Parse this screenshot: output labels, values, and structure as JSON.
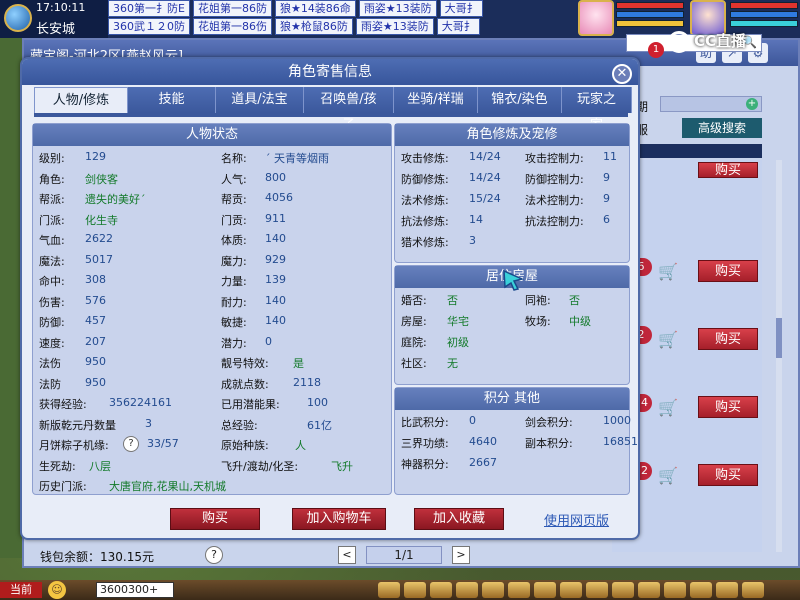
{
  "top": {
    "time": "17:10:11",
    "city": "长安城",
    "stalls_row1": [
      "360第一扌防E",
      "花姐第一86防",
      "狼★14装86命",
      "雨姿★13装防",
      "大哥扌"
    ],
    "stalls_row2": [
      "360武１２0防",
      "花姐第一86伤",
      "狼★枪鼠86防",
      "雨姿★13装防",
      "大哥扌"
    ]
  },
  "bg_window": {
    "title": "藏宝阁-河北2区[燕赵风云]",
    "icons": [
      "助",
      "↗",
      "⚙"
    ],
    "publicity_label": "公示期",
    "cross_server_label": "合跨服",
    "advanced_search": "高级搜索",
    "buy_label": "购买",
    "row_counts": [
      "6",
      "2",
      "54",
      "52"
    ],
    "wallet": "钱包余额：130.15元",
    "page": "1/1",
    "prev": "<",
    "next": ">",
    "help": "?"
  },
  "watermark": {
    "logo": "CC直播",
    "badge": "1"
  },
  "dialog": {
    "title": "角色寄售信息",
    "close": "✕",
    "tabs": [
      "人物/修炼",
      "技能",
      "道具/法宝",
      "召唤兽/孩子",
      "坐骑/祥瑞",
      "锦衣/染色",
      "玩家之家"
    ],
    "status": {
      "header": "人物状态",
      "left_col": [
        {
          "label": "级别:",
          "value": "129"
        },
        {
          "label": "角色:",
          "value": "剑侠客"
        },
        {
          "label": "帮派:",
          "value": "遗失的美好´"
        },
        {
          "label": "门派:",
          "value": "化生寺"
        },
        {
          "label": "气血:",
          "value": "2622"
        },
        {
          "label": "魔法:",
          "value": "5017"
        },
        {
          "label": "命中:",
          "value": "308"
        },
        {
          "label": "伤害:",
          "value": "576"
        },
        {
          "label": "防御:",
          "value": "457"
        },
        {
          "label": "速度:",
          "value": "207"
        },
        {
          "label": "法伤",
          "value": "950"
        },
        {
          "label": "法防",
          "value": "950"
        }
      ],
      "right_col": [
        {
          "label": "名称:",
          "value": "´ 天青等烟雨"
        },
        {
          "label": "人气:",
          "value": "800"
        },
        {
          "label": "帮贡:",
          "value": "4056"
        },
        {
          "label": "门贡:",
          "value": "911"
        },
        {
          "label": "体质:",
          "value": "140"
        },
        {
          "label": "魔力:",
          "value": "929"
        },
        {
          "label": "力量:",
          "value": "139"
        },
        {
          "label": "耐力:",
          "value": "140"
        },
        {
          "label": "敏捷:",
          "value": "140"
        },
        {
          "label": "潜力:",
          "value": "0"
        },
        {
          "label": "靓号特效:",
          "value": "是"
        },
        {
          "label": "成就点数:",
          "value": "2118"
        }
      ],
      "exp_label": "获得经验:",
      "exp_value": "356224161",
      "used_pot_label": "已用潜能果:",
      "used_pot_value": "100",
      "qiankun_label": "新版乾元丹数量",
      "qiankun_value": "3",
      "total_exp_label": "总经验:",
      "total_exp_value": "61亿",
      "mooncake_label": "月饼粽子机缘:",
      "mooncake_value": "33/57",
      "race_label": "原始种族:",
      "race_value": "人",
      "life_label": "生死劫:",
      "life_value": "八层",
      "ascend_label": "飞升/渡劫/化圣:",
      "ascend_value": "飞升",
      "history_label": "历史门派:",
      "history_value": "大唐官府,花果山,天机城"
    },
    "cultivation": {
      "header": "角色修炼及宠修",
      "rows": [
        {
          "l1": "攻击修炼:",
          "v1": "14/24",
          "l2": "攻击控制力:",
          "v2": "11"
        },
        {
          "l1": "防御修炼:",
          "v1": "14/24",
          "l2": "防御控制力:",
          "v2": "9"
        },
        {
          "l1": "法术修炼:",
          "v1": "15/24",
          "l2": "法术控制力:",
          "v2": "9"
        },
        {
          "l1": "抗法修炼:",
          "v1": "14",
          "l2": "抗法控制力:",
          "v2": "6"
        },
        {
          "l1": "猎术修炼:",
          "v1": "3",
          "l2": "",
          "v2": ""
        }
      ]
    },
    "house": {
      "header": "居住房屋",
      "rows": [
        {
          "l1": "婚否:",
          "v1": "否",
          "l2": "同袍:",
          "v2": "否"
        },
        {
          "l1": "房屋:",
          "v1": "华宅",
          "l2": "牧场:",
          "v2": "中级"
        },
        {
          "l1": "庭院:",
          "v1": "初级",
          "l2": "",
          "v2": ""
        },
        {
          "l1": "社区:",
          "v1": "无",
          "l2": "",
          "v2": ""
        }
      ]
    },
    "points": {
      "header": "积分 其他",
      "rows": [
        {
          "l1": "比武积分:",
          "v1": "0",
          "l2": "剑会积分:",
          "v2": "1000"
        },
        {
          "l1": "三界功绩:",
          "v1": "4640",
          "l2": "副本积分:",
          "v2": "16851"
        },
        {
          "l1": "神器积分:",
          "v1": "2667",
          "l2": "",
          "v2": ""
        }
      ]
    },
    "buttons": {
      "buy": "购买",
      "add_cart": "加入购物车",
      "add_fav": "加入收藏",
      "web": "使用网页版"
    }
  },
  "taskbar": {
    "current": "当前",
    "emoji": "☺",
    "input_value": "3600300+"
  },
  "colors": {
    "title_blue": "#3c5699",
    "buy_red": "#b02632",
    "value_blue": "#234b8f"
  }
}
